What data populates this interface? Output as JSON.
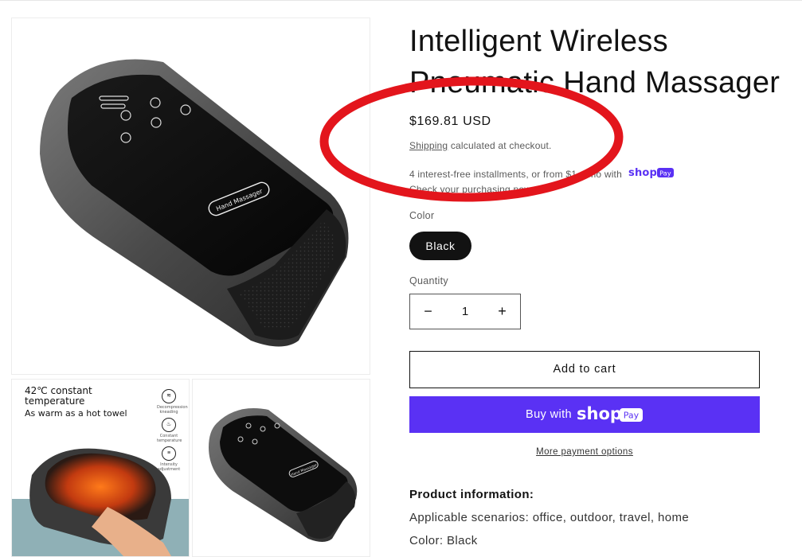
{
  "product": {
    "title": "Intelligent Wireless Pneumatic Hand Massager",
    "price": "$169.81 USD",
    "shipping_link": "Shipping",
    "shipping_rest": "calculated at checkout.",
    "install_line1": "4 interest-free installments, or from $1",
    "install_mo": "/mo with",
    "install_line2": "Check your purchasing pow"
  },
  "variant": {
    "color_label": "Color",
    "selected": "Black"
  },
  "quantity": {
    "label": "Quantity",
    "value": "1",
    "minus": "−",
    "plus": "+"
  },
  "actions": {
    "add_to_cart": "Add to cart",
    "buy_with": "Buy with",
    "shop": "shop",
    "pay": "Pay",
    "more_payment": "More payment options"
  },
  "gallery": {
    "main_device_label": "Hand Massager",
    "thumb1_line1": "42℃ constant",
    "thumb1_line2": "temperature",
    "thumb1_line3": "As warm as a hot towel",
    "thumb1_icon_captions": [
      "Decompression kneading",
      "Constant temperature",
      "Intensity adjustment"
    ],
    "thumb2_device_label": "Hand Massager"
  },
  "description": {
    "heading": "Product information:",
    "scenarios": "Applicable scenarios: office, outdoor, travel, home",
    "color": "Color: Black"
  },
  "colors": {
    "accent_shoppay": "#5a31f4",
    "annotation_red": "#e3151c",
    "text_primary": "#121212",
    "swatch_bg": "#121212"
  }
}
